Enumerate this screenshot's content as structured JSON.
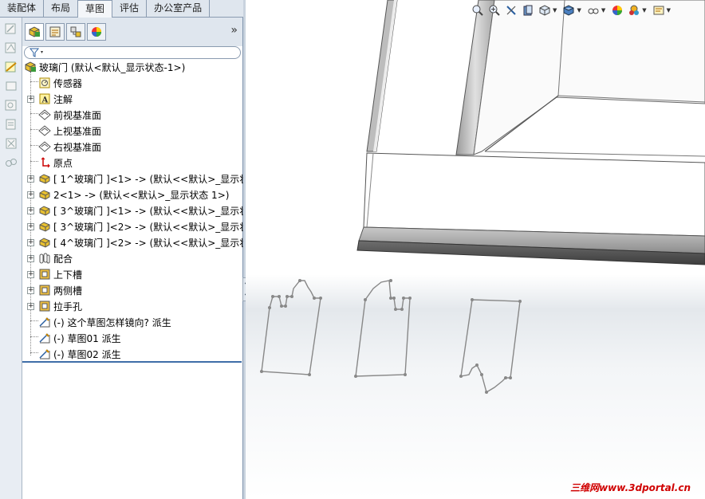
{
  "command_tabs": [
    {
      "label": "装配体",
      "active": false
    },
    {
      "label": "布局",
      "active": false
    },
    {
      "label": "草图",
      "active": true
    },
    {
      "label": "评估",
      "active": false
    },
    {
      "label": "办公室产品",
      "active": false
    }
  ],
  "left_strip_icons": [
    "sketch-icon",
    "smart-dimension-icon",
    "line-icon",
    "rectangle-icon",
    "circle-icon",
    "trim-icon",
    "offset-icon",
    "mirror-icon",
    "relations-icon"
  ],
  "panel_tabs": [
    {
      "name": "feature-manager-tab",
      "active": true
    },
    {
      "name": "property-manager-tab",
      "active": false
    },
    {
      "name": "configuration-manager-tab",
      "active": false
    },
    {
      "name": "display-manager-tab",
      "active": false
    }
  ],
  "panel_expand_glyph": "»",
  "tree": {
    "root": "玻璃门 (默认<默认_显示状态-1>)",
    "items": [
      {
        "label": "传感器",
        "icon": "sensor-icon",
        "expandable": false
      },
      {
        "label": "注解",
        "icon": "annotation-icon",
        "expandable": true
      },
      {
        "label": "前视基准面",
        "icon": "plane-icon",
        "expandable": false
      },
      {
        "label": "上视基准面",
        "icon": "plane-icon",
        "expandable": false
      },
      {
        "label": "右视基准面",
        "icon": "plane-icon",
        "expandable": false
      },
      {
        "label": "原点",
        "icon": "origin-icon",
        "expandable": false
      },
      {
        "label": "[ 1^玻璃门 ]<1> -> (默认<<默认>_显示状",
        "icon": "part-icon",
        "expandable": true
      },
      {
        "label": "2<1> -> (默认<<默认>_显示状态 1>)",
        "icon": "part-icon",
        "expandable": true
      },
      {
        "label": "[ 3^玻璃门 ]<1> -> (默认<<默认>_显示状",
        "icon": "part-icon",
        "expandable": true
      },
      {
        "label": "[ 3^玻璃门 ]<2> -> (默认<<默认>_显示状",
        "icon": "part-icon",
        "expandable": true
      },
      {
        "label": "[ 4^玻璃门 ]<2> -> (默认<<默认>_显示状",
        "icon": "part-icon",
        "expandable": true
      },
      {
        "label": "配合",
        "icon": "mates-icon",
        "expandable": true
      },
      {
        "label": "上下槽",
        "icon": "feature-icon",
        "expandable": true
      },
      {
        "label": "两侧槽",
        "icon": "feature-icon",
        "expandable": true
      },
      {
        "label": "拉手孔",
        "icon": "feature-icon",
        "expandable": true
      },
      {
        "label": "(-) 这个草图怎样镜向? 派生",
        "icon": "sketch-icon",
        "expandable": false
      },
      {
        "label": "(-) 草图01 派生",
        "icon": "sketch-icon",
        "expandable": false
      },
      {
        "label": "(-) 草图02 派生",
        "icon": "sketch-icon",
        "expandable": false
      }
    ]
  },
  "headsup_icons": [
    "zoom-to-fit-icon",
    "zoom-area-icon",
    "previous-view-icon",
    "section-view-icon",
    "view-orientation-icon",
    "display-style-icon",
    "hide-show-icon",
    "appearance-icon",
    "scene-icon",
    "view-settings-icon"
  ],
  "watermark": "三维网www.3dportal.cn",
  "colors": {
    "tab_bg": "#dfe6ee",
    "panel_border": "#7f94ad",
    "tree_end": "#3f6ea8",
    "watermark": "#d00000"
  }
}
